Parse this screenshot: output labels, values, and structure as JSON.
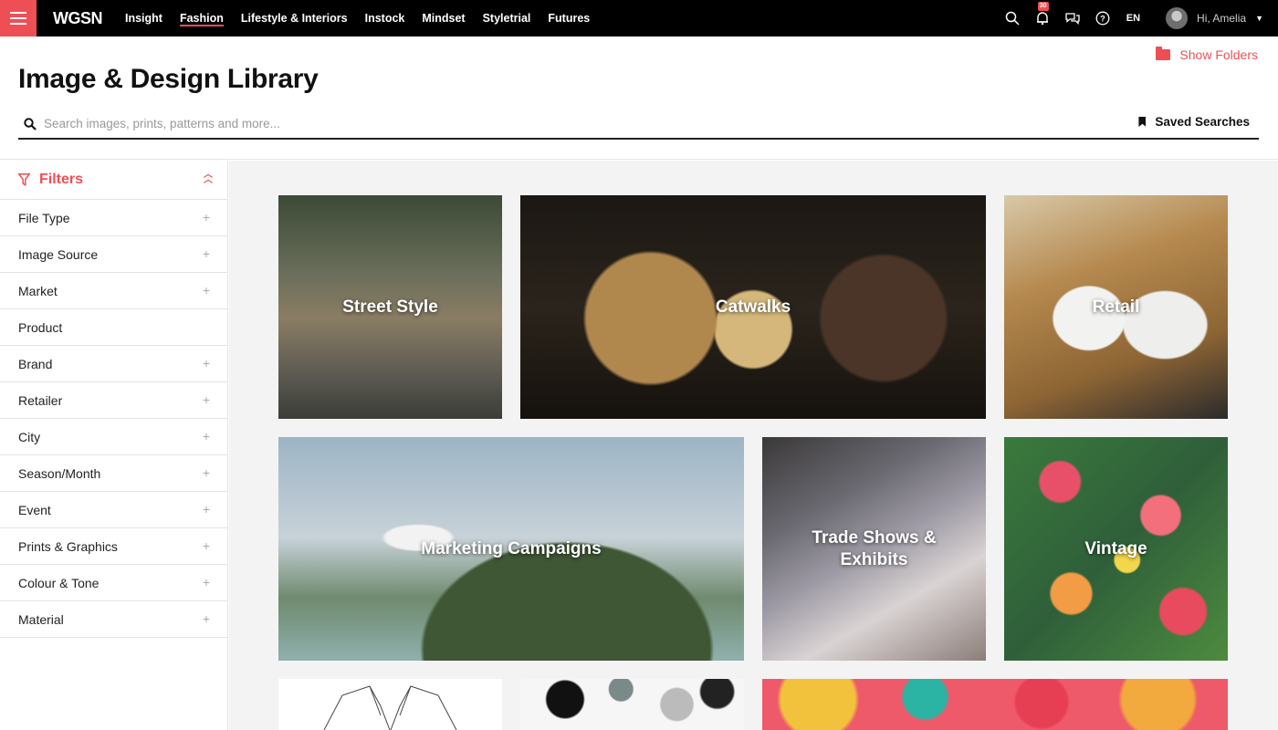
{
  "nav": {
    "logo": "WGSN",
    "links": [
      "Insight",
      "Fashion",
      "Lifestyle & Interiors",
      "Instock",
      "Mindset",
      "Styletrial",
      "Futures"
    ],
    "notification_count": "30",
    "language": "EN",
    "greeting": "Hi, Amelia"
  },
  "header": {
    "title": "Image & Design Library",
    "show_folders": "Show Folders",
    "search_placeholder": "Search images, prints, patterns and more...",
    "saved_searches": "Saved Searches"
  },
  "filters": {
    "title": "Filters",
    "items": [
      "File Type",
      "Image Source",
      "Market",
      "Product",
      "Brand",
      "Retailer",
      "City",
      "Season/Month",
      "Event",
      "Prints & Graphics",
      "Colour & Tone",
      "Material"
    ]
  },
  "tiles": [
    "Street Style",
    "Catwalks",
    "Retail",
    "Marketing Campaigns",
    "Trade Shows & Exhibits",
    "Vintage"
  ],
  "colors": {
    "accent": "#ee4f55",
    "nav_bg": "#000000",
    "grid_bg": "#f3f3f3"
  }
}
